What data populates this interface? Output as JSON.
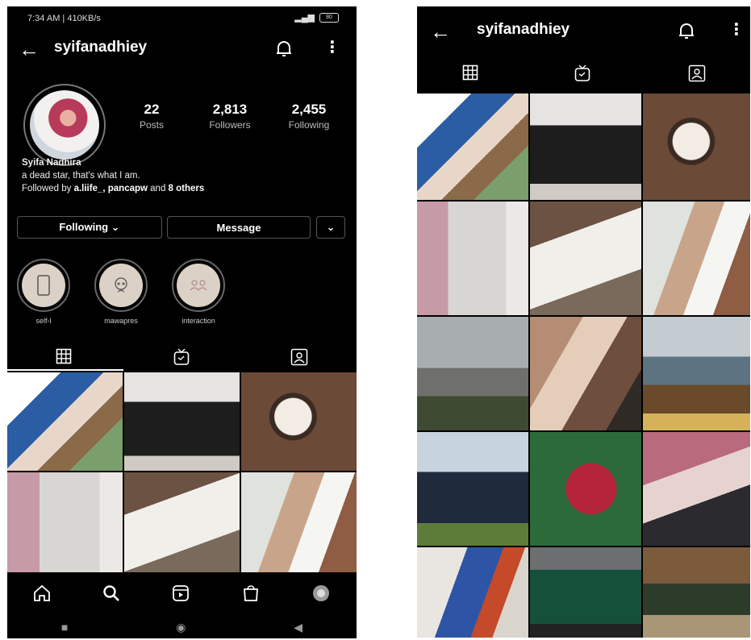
{
  "left": {
    "status": {
      "time": "7:34 AM | 410KB/s",
      "battery": "80"
    },
    "username": "syifanadhiey",
    "stats": [
      {
        "num": "22",
        "label": "Posts"
      },
      {
        "num": "2,813",
        "label": "Followers"
      },
      {
        "num": "2,455",
        "label": "Following"
      }
    ],
    "bio": {
      "name": "Syifa Nadhira",
      "line1": "a dead star, that's what I am.",
      "followed_prefix": "Followed by ",
      "followed_names": "a.liife_, pancapw",
      "followed_mid": " and ",
      "followed_others": "8 others"
    },
    "buttons": {
      "following": "Following ⌄",
      "message": "Message",
      "more": "⌄"
    },
    "highlights": [
      {
        "label": "self-l",
        "icon": "phone-icon"
      },
      {
        "label": "mawapres",
        "icon": "skull-icon"
      },
      {
        "label": "interaction",
        "icon": "people-icon"
      }
    ],
    "bottom_nav": [
      "home-icon",
      "search-icon",
      "reels-icon",
      "shop-icon",
      "profile-avatar"
    ],
    "system_nav": [
      "recent-apps-icon",
      "home-button-icon",
      "back-button-icon"
    ]
  },
  "right": {
    "username": "syifanadhiey"
  },
  "icons": {
    "back": "back-arrow-icon",
    "bell": "bell-icon",
    "more": "kebab-menu-icon"
  },
  "colors": {
    "background": "#000000",
    "text": "#ffffff",
    "muted": "#bbbbbb",
    "border": "#555555"
  }
}
